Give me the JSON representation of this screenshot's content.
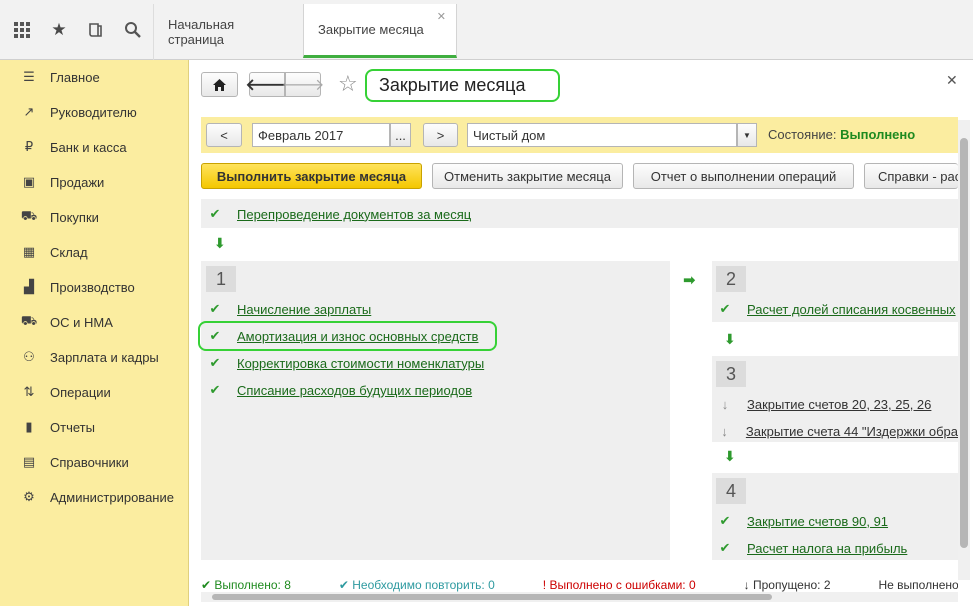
{
  "tabs": [
    {
      "label": "Начальная страница"
    },
    {
      "label": "Закрытие месяца"
    }
  ],
  "sidebar": {
    "items": [
      {
        "label": "Главное",
        "icon": "menu-lines-icon"
      },
      {
        "label": "Руководителю",
        "icon": "trend-chart-icon"
      },
      {
        "label": "Банк и касса",
        "icon": "ruble-coin-icon"
      },
      {
        "label": "Продажи",
        "icon": "shopping-bag-icon"
      },
      {
        "label": "Покупки",
        "icon": "cart-icon"
      },
      {
        "label": "Склад",
        "icon": "warehouse-icon"
      },
      {
        "label": "Производство",
        "icon": "factory-icon"
      },
      {
        "label": "ОС и НМА",
        "icon": "truck-icon"
      },
      {
        "label": "Зарплата и кадры",
        "icon": "people-icon"
      },
      {
        "label": "Операции",
        "icon": "debit-credit-icon"
      },
      {
        "label": "Отчеты",
        "icon": "bar-chart-icon"
      },
      {
        "label": "Справочники",
        "icon": "books-icon"
      },
      {
        "label": "Администрирование",
        "icon": "gear-icon"
      }
    ]
  },
  "form": {
    "title": "Закрытие месяца",
    "prev_label": "<",
    "next_label": ">",
    "period": "Февраль 2017",
    "period_picker": "...",
    "organization": "Чистый дом",
    "status_label": "Состояние:",
    "status_value": "Выполнено",
    "btn_run": "Выполнить закрытие месяца",
    "btn_cancel": "Отменить закрытие месяца",
    "btn_report": "Отчет о выполнении операций",
    "btn_refs": "Справки - рас"
  },
  "steps": {
    "top": "Перепроведение документов за месяц",
    "s1": {
      "num": "1",
      "items": [
        "Начисление зарплаты",
        "Амортизация и износ основных средств",
        "Корректировка стоимости номенклатуры",
        "Списание расходов будущих периодов"
      ]
    },
    "s2": {
      "num": "2",
      "items": [
        "Расчет долей списания косвенных"
      ]
    },
    "s3": {
      "num": "3",
      "items": [
        "Закрытие счетов 20, 23, 25, 26",
        "Закрытие счета 44 \"Издержки обра"
      ]
    },
    "s4": {
      "num": "4",
      "items": [
        "Закрытие счетов 90, 91",
        "Расчет налога на прибыль"
      ]
    }
  },
  "footer": {
    "done": "Выполнено: 8",
    "repeat": "Необходимо повторить: 0",
    "errors": "Выполнено с ошибками: 0",
    "skipped": "Пропущено: 2",
    "not_done": "Не выполнено"
  },
  "colors": {
    "accent_yellow": "#fbeda0",
    "success_green": "#2e9a2e",
    "highlight_green": "#36d136"
  }
}
